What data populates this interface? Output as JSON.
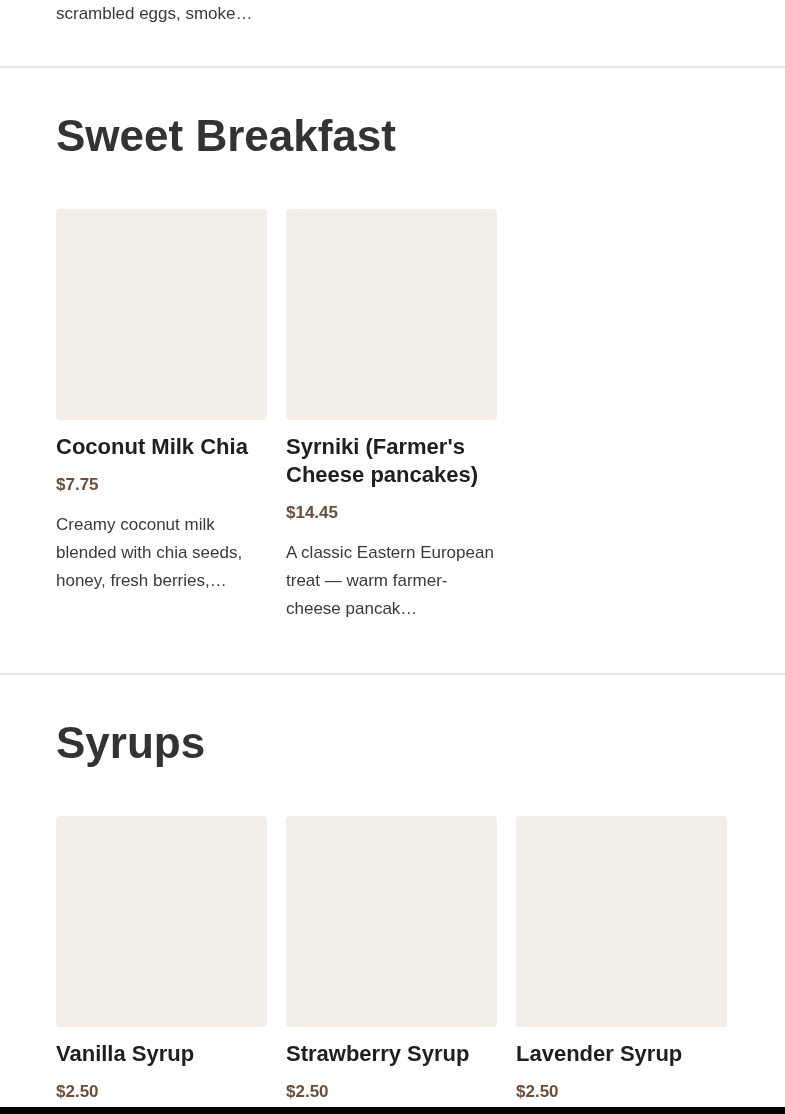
{
  "previous_section": {
    "description_tail": "scrambled eggs, smoke…"
  },
  "sections": [
    {
      "title": "Sweet Breakfast",
      "items": [
        {
          "name": "Coconut Milk Chia",
          "price": "$7.75",
          "description": "Creamy coconut milk blended with chia seeds, honey, fresh berries,…"
        },
        {
          "name": "Syrniki (Farmer's Cheese pancakes)",
          "price": "$14.45",
          "description": "A classic Eastern European treat — warm farmer-cheese pancak…"
        }
      ]
    },
    {
      "title": "Syrups",
      "items": [
        {
          "name": "Vanilla Syrup",
          "price": "$2.50"
        },
        {
          "name": "Strawberry Syrup",
          "price": "$2.50"
        },
        {
          "name": "Lavender Syrup",
          "price": "$2.50"
        }
      ]
    }
  ]
}
